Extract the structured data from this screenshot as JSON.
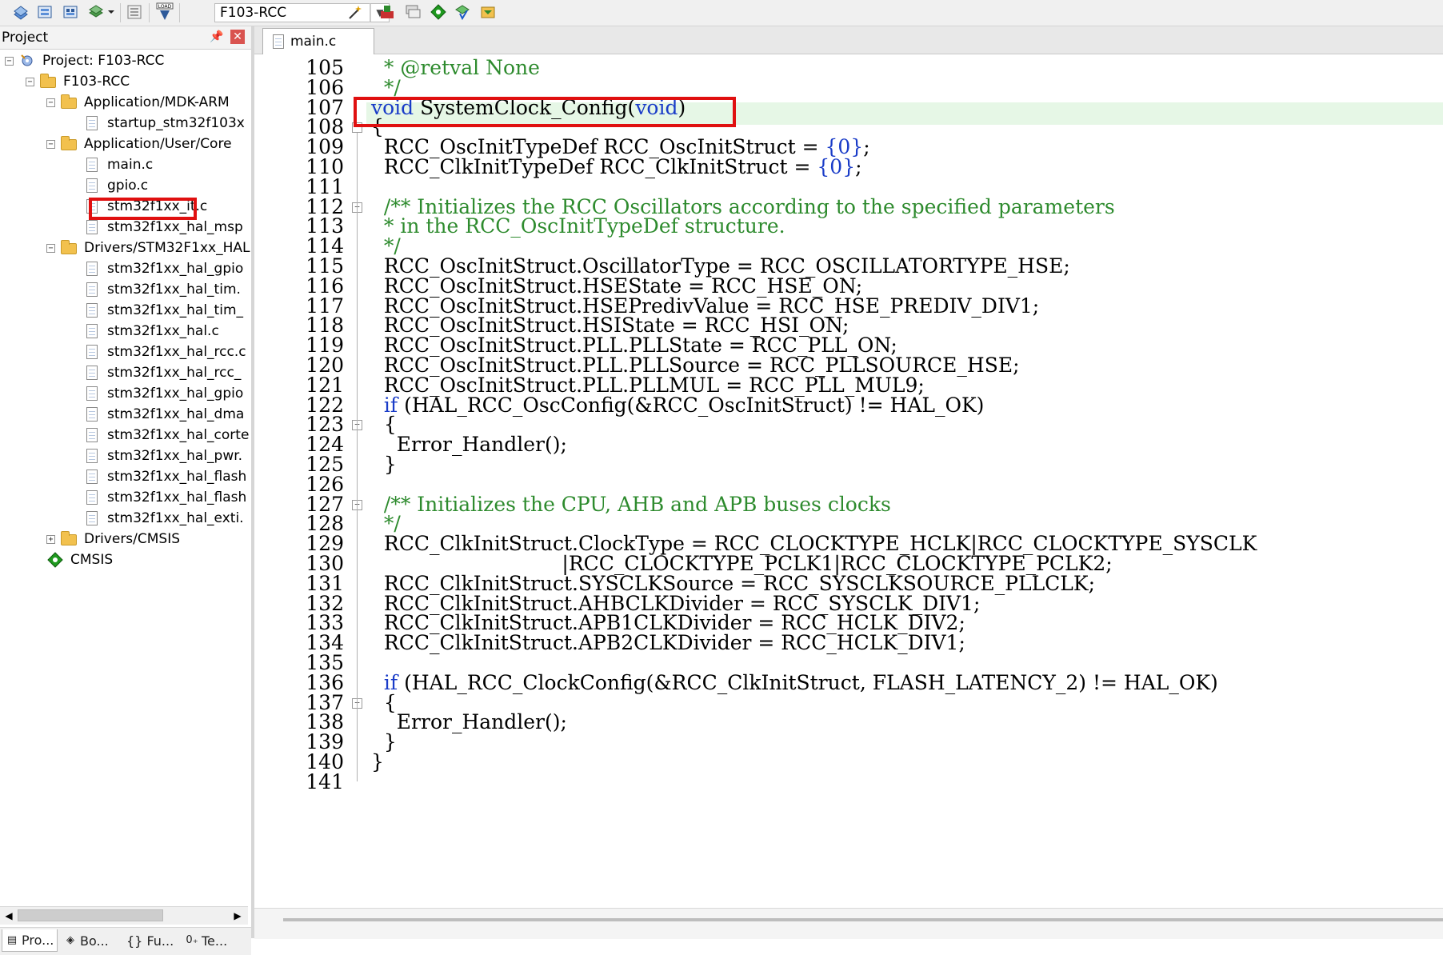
{
  "toolbar": {
    "target_name": "F103-RCC",
    "icons": [
      "build-icon",
      "download-icon",
      "options-icon",
      "batch-icon",
      "translate-icon",
      "load-icon",
      "magic-wand-icon",
      "manage-components-icon",
      "window-layout-icon",
      "pack-installer-icon",
      "select-software-icon",
      "event-recorder-icon"
    ]
  },
  "project_panel": {
    "title": "Project",
    "tree": [
      {
        "label": "Project: F103-RCC",
        "level": 0,
        "expander": "−",
        "icon": "project-icon"
      },
      {
        "label": "F103-RCC",
        "level": 1,
        "expander": "−",
        "icon": "target-folder-icon"
      },
      {
        "label": "Application/MDK-ARM",
        "level": 2,
        "expander": "−",
        "icon": "folder-icon"
      },
      {
        "label": "startup_stm32f103x",
        "level": 3,
        "icon": "file-icon"
      },
      {
        "label": "Application/User/Core",
        "level": 2,
        "expander": "−",
        "icon": "folder-icon"
      },
      {
        "label": "main.c",
        "level": 3,
        "icon": "file-icon",
        "highlighted": true
      },
      {
        "label": "gpio.c",
        "level": 3,
        "icon": "file-icon"
      },
      {
        "label": "stm32f1xx_it.c",
        "level": 3,
        "icon": "file-icon"
      },
      {
        "label": "stm32f1xx_hal_msp",
        "level": 3,
        "icon": "file-icon"
      },
      {
        "label": "Drivers/STM32F1xx_HAL",
        "level": 2,
        "expander": "−",
        "icon": "folder-icon"
      },
      {
        "label": "stm32f1xx_hal_gpio",
        "level": 3,
        "icon": "file-icon"
      },
      {
        "label": "stm32f1xx_hal_tim.",
        "level": 3,
        "icon": "file-icon"
      },
      {
        "label": "stm32f1xx_hal_tim_",
        "level": 3,
        "icon": "file-icon"
      },
      {
        "label": "stm32f1xx_hal.c",
        "level": 3,
        "icon": "file-icon"
      },
      {
        "label": "stm32f1xx_hal_rcc.c",
        "level": 3,
        "icon": "file-icon"
      },
      {
        "label": "stm32f1xx_hal_rcc_",
        "level": 3,
        "icon": "file-icon"
      },
      {
        "label": "stm32f1xx_hal_gpio",
        "level": 3,
        "icon": "file-icon"
      },
      {
        "label": "stm32f1xx_hal_dma",
        "level": 3,
        "icon": "file-icon"
      },
      {
        "label": "stm32f1xx_hal_corte",
        "level": 3,
        "icon": "file-icon"
      },
      {
        "label": "stm32f1xx_hal_pwr.",
        "level": 3,
        "icon": "file-icon"
      },
      {
        "label": "stm32f1xx_hal_flash",
        "level": 3,
        "icon": "file-icon"
      },
      {
        "label": "stm32f1xx_hal_flash",
        "level": 3,
        "icon": "file-icon"
      },
      {
        "label": "stm32f1xx_hal_exti.",
        "level": 3,
        "icon": "file-icon"
      },
      {
        "label": "Drivers/CMSIS",
        "level": 2,
        "expander": "+",
        "icon": "folder-icon"
      },
      {
        "label": "CMSIS",
        "level": 2,
        "icon": "cmsis-icon"
      }
    ],
    "bottom_tabs": [
      {
        "label": "Pro...",
        "icon": "project-tab-icon"
      },
      {
        "label": "Bo...",
        "icon": "books-tab-icon"
      },
      {
        "label": "{} Fu...",
        "icon": "functions-tab-icon"
      },
      {
        "label": "Te...",
        "icon": "templates-tab-icon"
      }
    ]
  },
  "editor": {
    "tab_label": "main.c",
    "lines": [
      {
        "num": "105",
        "fold": "",
        "tokens": [
          {
            "t": "  * @retval None",
            "c": "cm"
          }
        ]
      },
      {
        "num": "106",
        "fold": "",
        "tokens": [
          {
            "t": "  */",
            "c": "cm"
          }
        ]
      },
      {
        "num": "107",
        "fold": "",
        "tokens": [
          {
            "t": "void",
            "c": "kw"
          },
          {
            "t": " SystemClock_Config(",
            "c": ""
          },
          {
            "t": "void",
            "c": "kw"
          },
          {
            "t": ")",
            "c": ""
          }
        ]
      },
      {
        "num": "108",
        "fold": "−",
        "tokens": [
          {
            "t": "{",
            "c": ""
          }
        ]
      },
      {
        "num": "109",
        "fold": "",
        "tokens": [
          {
            "t": "  RCC_OscInitTypeDef RCC_OscInitStruct = ",
            "c": ""
          },
          {
            "t": "{0}",
            "c": "num"
          },
          {
            "t": ";",
            "c": ""
          }
        ]
      },
      {
        "num": "110",
        "fold": "",
        "tokens": [
          {
            "t": "  RCC_ClkInitTypeDef RCC_ClkInitStruct = ",
            "c": ""
          },
          {
            "t": "{0}",
            "c": "num"
          },
          {
            "t": ";",
            "c": ""
          }
        ]
      },
      {
        "num": "111",
        "fold": "",
        "tokens": [
          {
            "t": "",
            "c": ""
          }
        ]
      },
      {
        "num": "112",
        "fold": "−",
        "tokens": [
          {
            "t": "  /** Initializes the RCC Oscillators according to the specified parameters",
            "c": "cm"
          }
        ]
      },
      {
        "num": "113",
        "fold": "",
        "tokens": [
          {
            "t": "  * in the RCC_OscInitTypeDef structure.",
            "c": "cm"
          }
        ]
      },
      {
        "num": "114",
        "fold": "",
        "tokens": [
          {
            "t": "  */",
            "c": "cm"
          }
        ]
      },
      {
        "num": "115",
        "fold": "",
        "tokens": [
          {
            "t": "  RCC_OscInitStruct.OscillatorType = RCC_OSCILLATORTYPE_HSE;",
            "c": ""
          }
        ]
      },
      {
        "num": "116",
        "fold": "",
        "tokens": [
          {
            "t": "  RCC_OscInitStruct.HSEState = RCC_HSE_ON;",
            "c": ""
          }
        ]
      },
      {
        "num": "117",
        "fold": "",
        "tokens": [
          {
            "t": "  RCC_OscInitStruct.HSEPredivValue = RCC_HSE_PREDIV_DIV1;",
            "c": ""
          }
        ]
      },
      {
        "num": "118",
        "fold": "",
        "tokens": [
          {
            "t": "  RCC_OscInitStruct.HSIState = RCC_HSI_ON;",
            "c": ""
          }
        ]
      },
      {
        "num": "119",
        "fold": "",
        "tokens": [
          {
            "t": "  RCC_OscInitStruct.PLL.PLLState = RCC_PLL_ON;",
            "c": ""
          }
        ]
      },
      {
        "num": "120",
        "fold": "",
        "tokens": [
          {
            "t": "  RCC_OscInitStruct.PLL.PLLSource = RCC_PLLSOURCE_HSE;",
            "c": ""
          }
        ]
      },
      {
        "num": "121",
        "fold": "",
        "tokens": [
          {
            "t": "  RCC_OscInitStruct.PLL.PLLMUL = RCC_PLL_MUL9;",
            "c": ""
          }
        ]
      },
      {
        "num": "122",
        "fold": "",
        "tokens": [
          {
            "t": "  ",
            "c": ""
          },
          {
            "t": "if",
            "c": "kw"
          },
          {
            "t": " (HAL_RCC_OscConfig(&RCC_OscInitStruct) != HAL_OK)",
            "c": ""
          }
        ]
      },
      {
        "num": "123",
        "fold": "−",
        "tokens": [
          {
            "t": "  {",
            "c": ""
          }
        ]
      },
      {
        "num": "124",
        "fold": "",
        "tokens": [
          {
            "t": "    Error_Handler();",
            "c": ""
          }
        ]
      },
      {
        "num": "125",
        "fold": "",
        "tokens": [
          {
            "t": "  }",
            "c": ""
          }
        ]
      },
      {
        "num": "126",
        "fold": "",
        "tokens": [
          {
            "t": "",
            "c": ""
          }
        ]
      },
      {
        "num": "127",
        "fold": "−",
        "tokens": [
          {
            "t": "  /** Initializes the CPU, AHB and APB buses clocks",
            "c": "cm"
          }
        ]
      },
      {
        "num": "128",
        "fold": "",
        "tokens": [
          {
            "t": "  */",
            "c": "cm"
          }
        ]
      },
      {
        "num": "129",
        "fold": "",
        "tokens": [
          {
            "t": "  RCC_ClkInitStruct.ClockType = RCC_CLOCKTYPE_HCLK|RCC_CLOCKTYPE_SYSCLK",
            "c": ""
          }
        ]
      },
      {
        "num": "130",
        "fold": "",
        "tokens": [
          {
            "t": "                              |RCC_CLOCKTYPE_PCLK1|RCC_CLOCKTYPE_PCLK2;",
            "c": ""
          }
        ]
      },
      {
        "num": "131",
        "fold": "",
        "tokens": [
          {
            "t": "  RCC_ClkInitStruct.SYSCLKSource = RCC_SYSCLKSOURCE_PLLCLK;",
            "c": ""
          }
        ]
      },
      {
        "num": "132",
        "fold": "",
        "tokens": [
          {
            "t": "  RCC_ClkInitStruct.AHBCLKDivider = RCC_SYSCLK_DIV1;",
            "c": ""
          }
        ]
      },
      {
        "num": "133",
        "fold": "",
        "tokens": [
          {
            "t": "  RCC_ClkInitStruct.APB1CLKDivider = RCC_HCLK_DIV2;",
            "c": ""
          }
        ]
      },
      {
        "num": "134",
        "fold": "",
        "tokens": [
          {
            "t": "  RCC_ClkInitStruct.APB2CLKDivider = RCC_HCLK_DIV1;",
            "c": ""
          }
        ]
      },
      {
        "num": "135",
        "fold": "",
        "tokens": [
          {
            "t": "",
            "c": ""
          }
        ]
      },
      {
        "num": "136",
        "fold": "",
        "tokens": [
          {
            "t": "  ",
            "c": ""
          },
          {
            "t": "if",
            "c": "kw"
          },
          {
            "t": " (HAL_RCC_ClockConfig(&RCC_ClkInitStruct, FLASH_LATENCY_2) != HAL_OK)",
            "c": ""
          }
        ]
      },
      {
        "num": "137",
        "fold": "−",
        "tokens": [
          {
            "t": "  {",
            "c": ""
          }
        ]
      },
      {
        "num": "138",
        "fold": "",
        "tokens": [
          {
            "t": "    Error_Handler();",
            "c": ""
          }
        ]
      },
      {
        "num": "139",
        "fold": "",
        "tokens": [
          {
            "t": "  }",
            "c": ""
          }
        ]
      },
      {
        "num": "140",
        "fold": "",
        "tokens": [
          {
            "t": "}",
            "c": ""
          }
        ]
      },
      {
        "num": "141",
        "fold": "",
        "tokens": [
          {
            "t": "",
            "c": ""
          }
        ]
      }
    ]
  },
  "colors": {
    "keyword": "#1a3cc8",
    "comment": "#2e8b2e",
    "highlight_box": "#e01010",
    "current_line": "#e6f7e6"
  }
}
